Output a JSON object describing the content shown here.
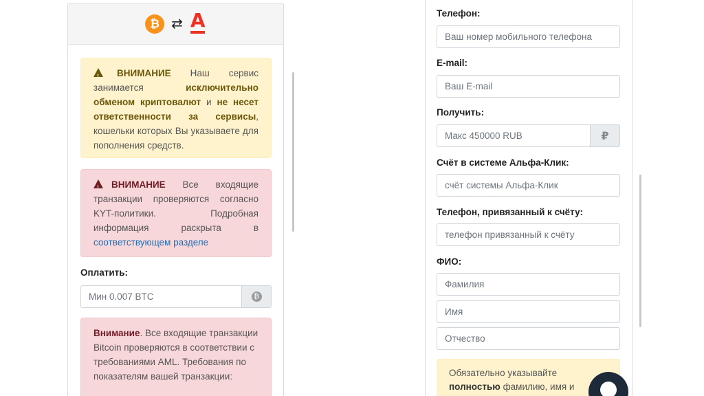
{
  "left": {
    "header": {
      "swap_symbol": "⇄"
    },
    "warning1": {
      "title": "ВНИМАНИЕ",
      "text1": " Наш сервис занимается ",
      "bold1": "исключительно обменом криптовалют",
      "text2": " и ",
      "bold2": "не несет ответственности за сервисы",
      "text3": ", кошельки которых Вы указываете для пополнения средств."
    },
    "warning2": {
      "title": "ВНИМАНИЕ",
      "text1": " Все входящие транзакции проверяются согласно KYT-политики. Подробная информация раскрыта в ",
      "link": "соответствующем разделе"
    },
    "pay_label": "Оплатить:",
    "pay_placeholder": "Мин 0.007 BTC",
    "warning3": {
      "title": "Внимание",
      "text": ". Все входящие транзакции Bitcoin проверяются в соответствии с требованиями AML. Требования по показателям вашей транзакции:"
    }
  },
  "right": {
    "phone_label": "Телефон:",
    "phone_placeholder": "Ваш номер мобильного телефона",
    "email_label": "E-mail:",
    "email_placeholder": "Ваш E-mail",
    "receive_label": "Получить:",
    "receive_placeholder": "Макс 450000 RUB",
    "rub_symbol": "₽",
    "account_label": "Счёт в системе Альфа-Клик:",
    "account_placeholder": "счёт системы Альфа-Клик",
    "linked_phone_label": "Телефон, привязанный к счёту:",
    "linked_phone_placeholder": "телефон привязанный к счёту",
    "fio_label": "ФИО:",
    "surname_placeholder": "Фамилия",
    "name_placeholder": "Имя",
    "patronymic_placeholder": "Отчество",
    "note": {
      "text1": "Обязательно указывайте ",
      "bold": "полностью",
      "text2": " фамилию, имя и отчество"
    }
  },
  "colors": {
    "bitcoin": "#f7931a",
    "alfa": "#ef3124",
    "warning_bg": "#fff3cd",
    "danger_bg": "#f8d7da",
    "link": "#1d6fb8",
    "chat_button": "#1d2a3a"
  }
}
